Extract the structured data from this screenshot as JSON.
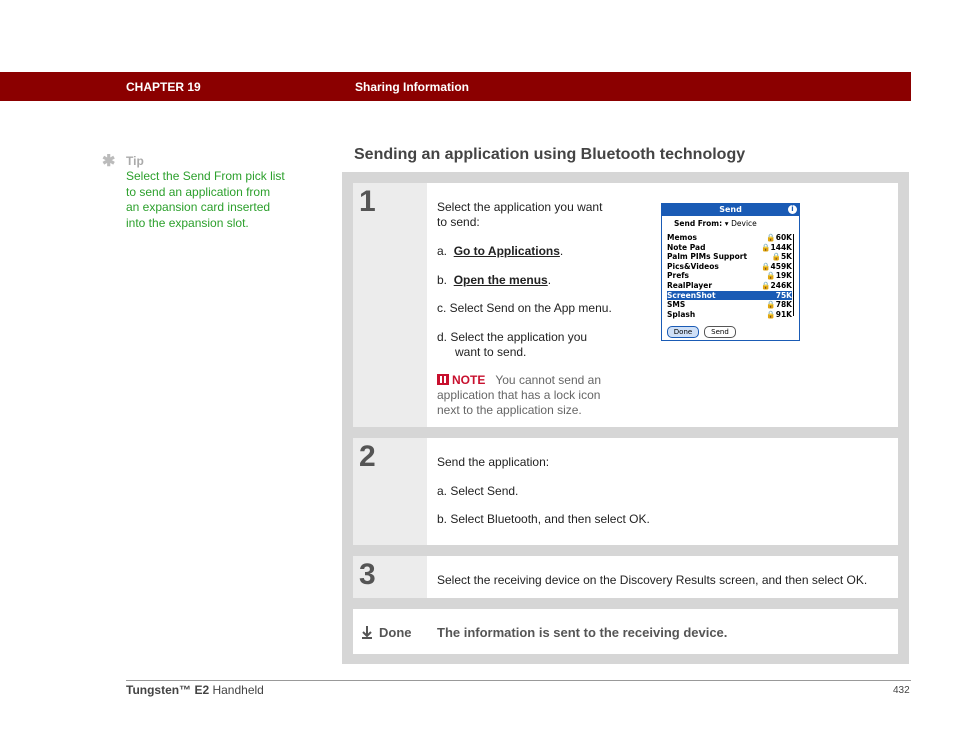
{
  "header": {
    "chapter": "CHAPTER 19",
    "section": "Sharing Information",
    "bar_color": "#8b0000"
  },
  "tip": {
    "icon": "asterisk-icon",
    "label": "Tip",
    "text": "Select the Send From pick list to send an application from an expansion card inserted into the expansion slot."
  },
  "title": "Sending an application using Bluetooth technology",
  "steps": [
    {
      "number": "1",
      "intro_1": "Select the application you want",
      "intro_2": "to send:",
      "a_prefix": "a.",
      "a_link": "Go to Applications",
      "a_suffix": ".",
      "b_prefix": "b.",
      "b_link": "Open the menus",
      "b_suffix": ".",
      "c": "c.  Select Send on the App menu.",
      "d_1": "d.  Select the application you",
      "d_2": "want to send.",
      "note_label": "NOTE",
      "note_1": "You cannot send an",
      "note_2": "application that has a lock icon",
      "note_3": "next to the application size."
    },
    {
      "number": "2",
      "intro": "Send the application:",
      "a": "a.  Select Send.",
      "b": "b.  Select Bluetooth, and then select OK."
    },
    {
      "number": "3",
      "text": "Select the receiving device on the Discovery Results screen, and then select OK."
    }
  ],
  "done": {
    "label": "Done",
    "text": "The information is sent to the receiving device."
  },
  "palm_screen": {
    "title": "Send",
    "send_from_label": "Send From:",
    "send_from_value": "Device",
    "items": [
      {
        "name": "Memos",
        "size": "60K",
        "locked": true
      },
      {
        "name": "Note Pad",
        "size": "144K",
        "locked": true
      },
      {
        "name": "Palm PIMs Support",
        "size": "5K",
        "locked": true
      },
      {
        "name": "Pics&Videos",
        "size": "459K",
        "locked": true
      },
      {
        "name": "Prefs",
        "size": "19K",
        "locked": true
      },
      {
        "name": "RealPlayer",
        "size": "246K",
        "locked": true
      },
      {
        "name": "ScreenShot",
        "size": "75K",
        "locked": false,
        "selected": true
      },
      {
        "name": "SMS",
        "size": "78K",
        "locked": true
      },
      {
        "name": "Splash",
        "size": "91K",
        "locked": true
      }
    ],
    "done_button": "Done",
    "send_button": "Send"
  },
  "footer": {
    "product": "Tungsten™ E2",
    "product_suffix": "Handheld",
    "page": "432"
  }
}
